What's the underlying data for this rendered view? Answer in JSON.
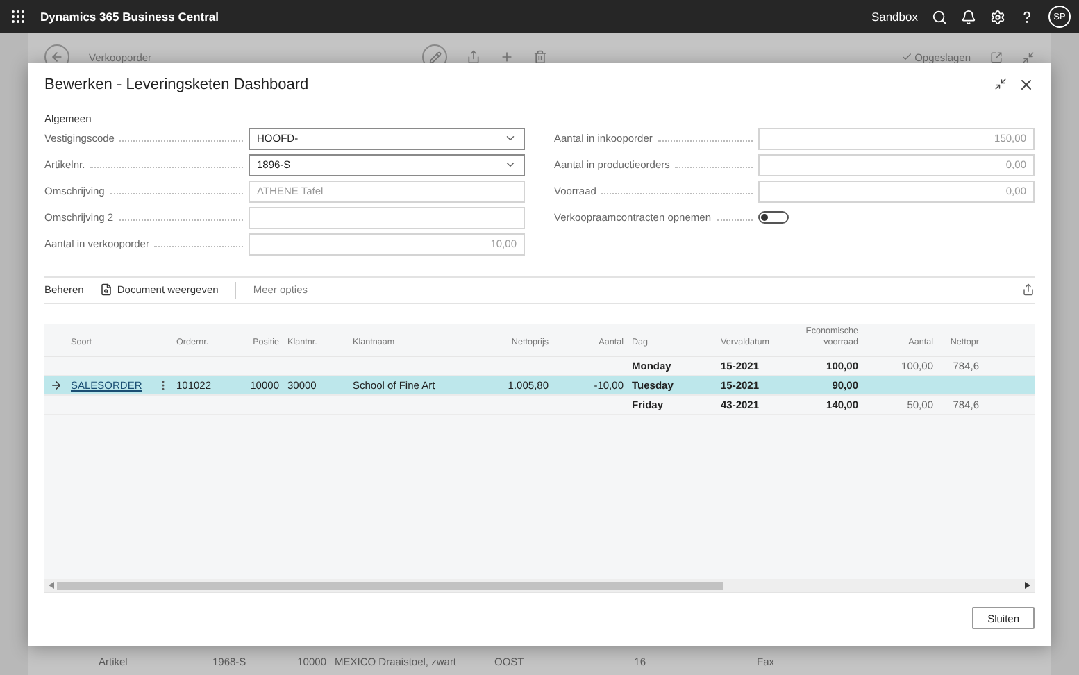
{
  "top_bar": {
    "app_name": "Dynamics 365 Business Central",
    "environment": "Sandbox",
    "avatar_initials": "SP"
  },
  "background_page": {
    "title": "Verkooporder",
    "status": "Opgeslagen",
    "line_cells": [
      "Artikel",
      "1968-S",
      "10000",
      "MEXICO Draaistoel, zwart",
      "OOST",
      "16"
    ],
    "side_label": "Fax"
  },
  "dialog": {
    "title": "Bewerken - Leveringsketen Dashboard",
    "section": "Algemeen",
    "left_fields": [
      {
        "label": "Vestigingscode",
        "value": "HOOFD-",
        "kind": "dropdown"
      },
      {
        "label": "Artikelnr.",
        "value": "1896-S",
        "kind": "dropdown"
      },
      {
        "label": "Omschrijving",
        "value": "ATHENE Tafel",
        "kind": "text"
      },
      {
        "label": "Omschrijving 2",
        "kind": "text"
      },
      {
        "label": "Aantal in verkooporder",
        "value": "10,00",
        "kind": "number"
      }
    ],
    "right_fields": [
      {
        "label": "Aantal in inkooporder",
        "value": "150,00",
        "kind": "number"
      },
      {
        "label": "Aantal in productieorders",
        "value": "0,00",
        "kind": "number"
      },
      {
        "label": "Voorraad",
        "value": "0,00",
        "kind": "number"
      },
      {
        "label": "Verkoopraamcontracten opnemen",
        "kind": "toggle",
        "on": false
      }
    ],
    "actions": [
      {
        "label": "Beheren",
        "kind": "plain"
      },
      {
        "label": "Document weergeven",
        "kind": "document"
      },
      {
        "label": "Meer opties",
        "kind": "more"
      }
    ],
    "table": {
      "columns": [
        {
          "label": "Soort",
          "kind": "link"
        },
        {
          "label": "Ordernr.",
          "kind": "text"
        },
        {
          "label": "Positie",
          "kind": "number"
        },
        {
          "label": "Klantnr.",
          "kind": "text"
        },
        {
          "label": "Klantnaam",
          "kind": "text"
        },
        {
          "label": "Nettoprijs",
          "kind": "number"
        },
        {
          "label": "Aantal",
          "kind": "number"
        },
        {
          "label": "Dag",
          "kind": "bold"
        },
        {
          "label": "Vervaldatum",
          "kind": "bold"
        },
        {
          "label": "Economische voorraad",
          "kind": "bold-number"
        },
        {
          "label": "Aantal",
          "kind": "number"
        },
        {
          "label": "Nettopr",
          "kind": "number"
        }
      ],
      "rows": [
        {
          "selected": false,
          "cells": [
            null,
            null,
            null,
            null,
            null,
            null,
            null,
            "Monday",
            "15-2021",
            "100,00",
            "100,00",
            "784,6"
          ]
        },
        {
          "selected": true,
          "cells": [
            "SALESORDER",
            "101022",
            "10000",
            "30000",
            "School of Fine Art",
            "1.005,80",
            "-10,00",
            "Tuesday",
            "15-2021",
            "90,00",
            null,
            null
          ]
        },
        {
          "selected": false,
          "cells": [
            null,
            null,
            null,
            null,
            null,
            null,
            null,
            "Friday",
            "43-2021",
            "140,00",
            "50,00",
            "784,6"
          ]
        }
      ]
    },
    "buttons": [
      "Sluiten"
    ]
  }
}
